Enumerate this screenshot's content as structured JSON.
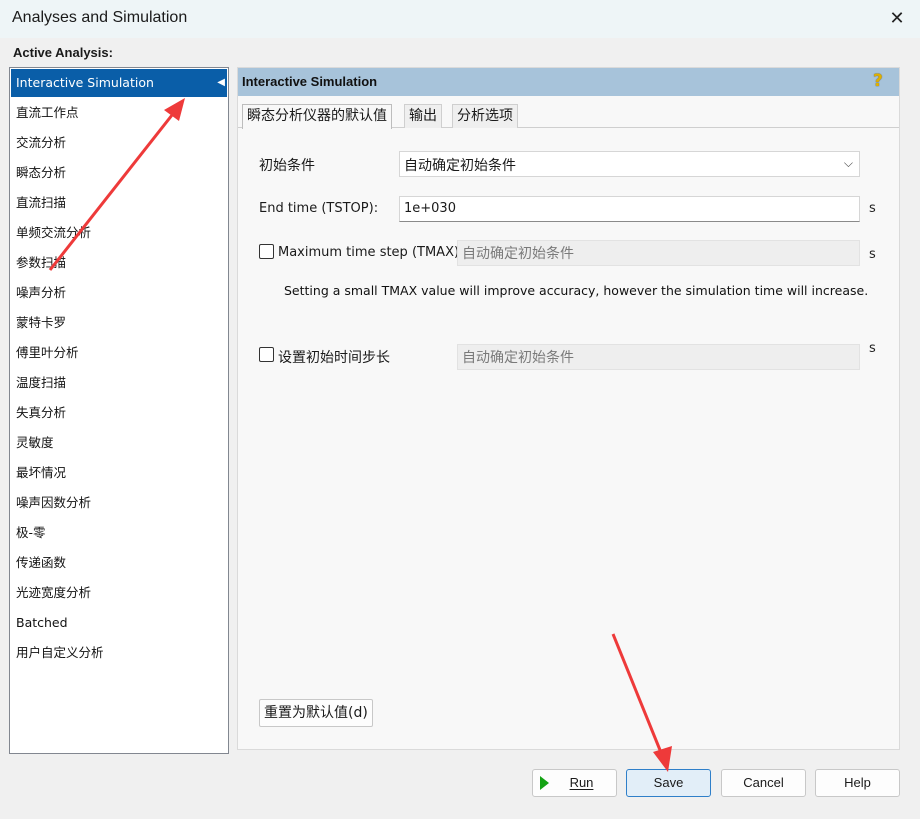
{
  "window": {
    "title": "Analyses and Simulation"
  },
  "active_analysis_label": "Active Analysis:",
  "analyses": [
    "Interactive Simulation",
    "直流工作点",
    "交流分析",
    "瞬态分析",
    "直流扫描",
    "单频交流分析",
    "参数扫描",
    "噪声分析",
    "蒙特卡罗",
    "傅里叶分析",
    "温度扫描",
    "失真分析",
    "灵敏度",
    "最坏情况",
    "噪声因数分析",
    "极-零",
    "传递函数",
    "光迹宽度分析",
    "Batched",
    "用户自定义分析"
  ],
  "selected_analysis": "Interactive Simulation",
  "panel": {
    "title": "Interactive Simulation",
    "help_glyph": "?",
    "tabs": [
      "瞬态分析仪器的默认值",
      "输出",
      "分析选项"
    ],
    "initial_conditions": {
      "label": "初始条件",
      "value": "自动确定初始条件"
    },
    "end_time": {
      "label": "End time (TSTOP):",
      "value": "1e+030",
      "unit": "s"
    },
    "max_time_step": {
      "label": "Maximum time step (TMAX):",
      "value": "自动确定初始条件",
      "unit": "s",
      "checked": false
    },
    "info": "Setting a small TMAX value will improve accuracy, however the simulation time will increase.",
    "initial_time_step": {
      "label": "设置初始时间步长",
      "value": "自动确定初始条件",
      "unit": "s",
      "checked": false
    },
    "reset_button": "重置为默认值(d)"
  },
  "buttons": {
    "run": "Run",
    "save": "Save",
    "cancel": "Cancel",
    "help": "Help"
  },
  "colors": {
    "selection": "#0a5ea8",
    "panel_header": "#a7c3da",
    "annotation_arrow": "#ee3a3a",
    "run_icon": "#14a214"
  }
}
